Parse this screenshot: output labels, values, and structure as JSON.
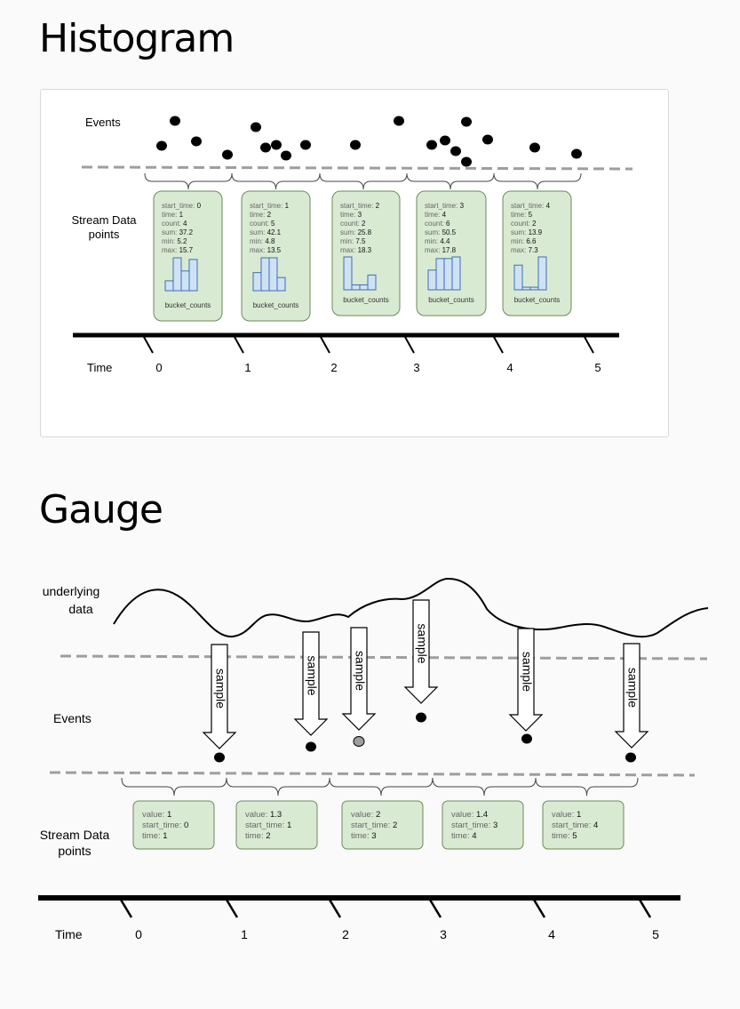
{
  "histogram": {
    "title": "Histogram",
    "labels": {
      "events": "Events",
      "stream": [
        "Stream Data",
        "points"
      ],
      "time": "Time"
    },
    "ticks": [
      "0",
      "1",
      "2",
      "3",
      "4",
      "5"
    ],
    "points": [
      {
        "fields": [
          [
            "start_time",
            "0"
          ],
          [
            "time",
            "1"
          ],
          [
            "count",
            "4"
          ],
          [
            "sum",
            "37.2"
          ],
          [
            "min",
            "5.2"
          ],
          [
            "max",
            "15.7"
          ]
        ],
        "buckets": [
          0.3,
          1.0,
          0.6,
          0.95
        ],
        "bucket_label": "bucket_counts"
      },
      {
        "fields": [
          [
            "start_time",
            "1"
          ],
          [
            "time",
            "2"
          ],
          [
            "count",
            "5"
          ],
          [
            "sum",
            "42.1"
          ],
          [
            "min",
            "4.8"
          ],
          [
            "max",
            "13.5"
          ]
        ],
        "buckets": [
          0.55,
          1.0,
          1.0,
          0.4
        ],
        "bucket_label": "bucket_counts"
      },
      {
        "fields": [
          [
            "start_time",
            "2"
          ],
          [
            "time",
            "3"
          ],
          [
            "count",
            "2"
          ],
          [
            "sum",
            "25.8"
          ],
          [
            "min",
            "7.5"
          ],
          [
            "max",
            "18.3"
          ]
        ],
        "buckets": [
          1.0,
          0.15,
          0.15,
          0.45
        ],
        "bucket_label": "bucket_counts"
      },
      {
        "fields": [
          [
            "start_time",
            "3"
          ],
          [
            "time",
            "4"
          ],
          [
            "count",
            "6"
          ],
          [
            "sum",
            "50.5"
          ],
          [
            "min",
            "4.4"
          ],
          [
            "max",
            "17.8"
          ]
        ],
        "buckets": [
          0.6,
          0.95,
          0.95,
          1.0
        ],
        "bucket_label": "bucket_counts"
      },
      {
        "fields": [
          [
            "start_time",
            "4"
          ],
          [
            "time",
            "5"
          ],
          [
            "count",
            "2"
          ],
          [
            "sum",
            "13.9"
          ],
          [
            "min",
            "6.6"
          ],
          [
            "max",
            "7.3"
          ]
        ],
        "buckets": [
          0.75,
          0.08,
          0.08,
          1.0
        ],
        "bucket_label": "bucket_counts"
      }
    ]
  },
  "gauge": {
    "title": "Gauge",
    "labels": {
      "underlying": [
        "underlying",
        "data"
      ],
      "events": "Events",
      "stream": [
        "Stream Data",
        "points"
      ],
      "time": "Time"
    },
    "sample_label": "sample",
    "ticks": [
      "0",
      "1",
      "2",
      "3",
      "4",
      "5"
    ],
    "points": [
      {
        "fields": [
          [
            "value",
            "1"
          ],
          [
            "start_time",
            "0"
          ],
          [
            "time",
            "1"
          ]
        ]
      },
      {
        "fields": [
          [
            "value",
            "1.3"
          ],
          [
            "start_time",
            "1"
          ],
          [
            "time",
            "2"
          ]
        ]
      },
      {
        "fields": [
          [
            "value",
            "2"
          ],
          [
            "start_time",
            "2"
          ],
          [
            "time",
            "3"
          ]
        ]
      },
      {
        "fields": [
          [
            "value",
            "1.4"
          ],
          [
            "start_time",
            "3"
          ],
          [
            "time",
            "4"
          ]
        ]
      },
      {
        "fields": [
          [
            "value",
            "1"
          ],
          [
            "start_time",
            "4"
          ],
          [
            "time",
            "5"
          ]
        ]
      }
    ]
  },
  "colors": {
    "box_fill": "#d9ead3",
    "box_stroke": "#6a8a5a",
    "bar_fill": "#cfe2f3",
    "bar_stroke": "#3d6fb4",
    "dash": "#9e9e9e",
    "grey_dot": "#9e9e9e"
  }
}
